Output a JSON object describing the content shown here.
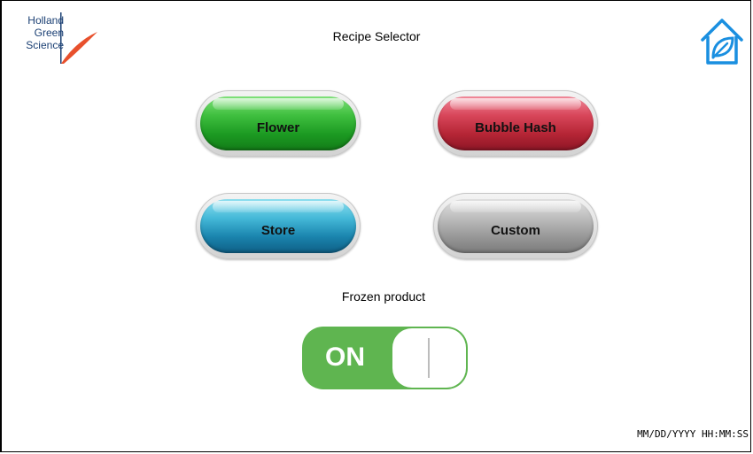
{
  "header": {
    "logo_lines": [
      "Holland",
      "Green",
      "Science"
    ],
    "title": "Recipe Selector"
  },
  "recipes": {
    "flower": "Flower",
    "bubble_hash": "Bubble Hash",
    "store": "Store",
    "custom": "Custom"
  },
  "frozen": {
    "label": "Frozen product",
    "state": "ON"
  },
  "footer": {
    "datetime": "MM/DD/YYYY HH:MM:SS"
  },
  "colors": {
    "flower": "#1c9a22",
    "bubble_hash": "#b52535",
    "store": "#1a84ad",
    "custom": "#979797",
    "toggle_on": "#5fb550",
    "home_icon": "#1a8fe0"
  },
  "icons": {
    "home": "house-leaf-icon"
  }
}
